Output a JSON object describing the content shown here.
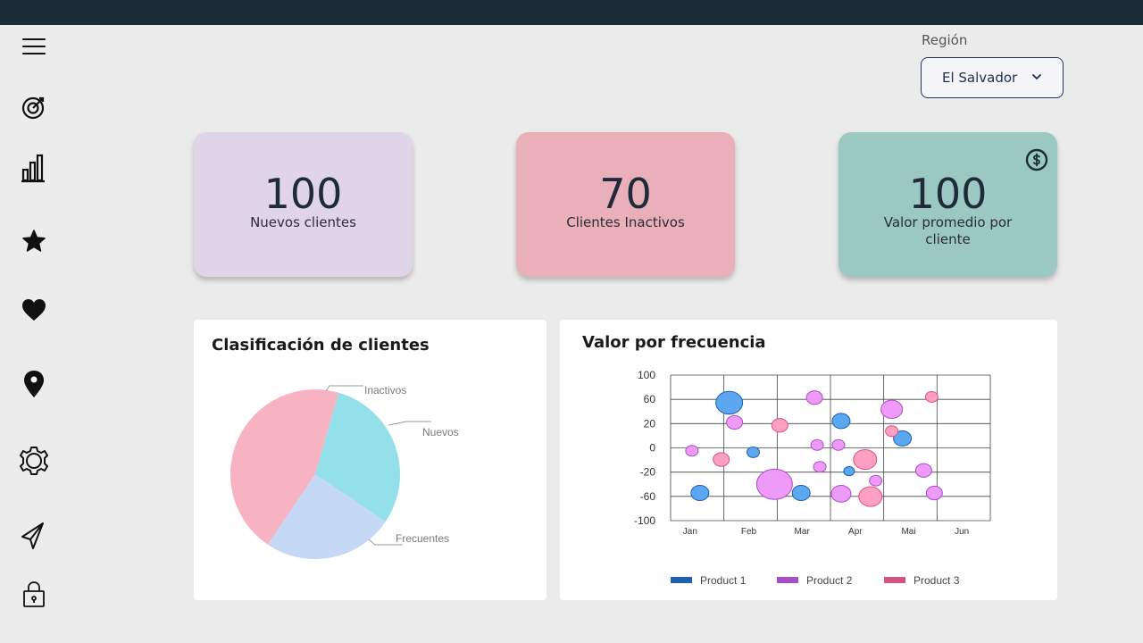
{
  "sidebar": {
    "items": [
      {
        "icon": "menu-icon"
      },
      {
        "icon": "target-icon"
      },
      {
        "icon": "bar-chart-icon"
      },
      {
        "icon": "star-icon"
      },
      {
        "icon": "heart-icon"
      },
      {
        "icon": "map-pin-icon"
      },
      {
        "icon": "settings-icon"
      },
      {
        "icon": "send-icon"
      },
      {
        "icon": "lock-icon"
      }
    ]
  },
  "filter": {
    "label": "Región",
    "value": "El Salvador"
  },
  "kpis": [
    {
      "value": "100",
      "label": "Nuevos clientes",
      "color": "#e0d4e8"
    },
    {
      "value": "70",
      "label": "Clientes Inactivos",
      "color": "#e9b0b9"
    },
    {
      "value": "100",
      "label": "Valor promedio por cliente",
      "color": "#9bc8c1",
      "icon": "dollar-icon"
    }
  ],
  "charts": [
    {
      "title": "Clasificación de clientes",
      "chart_data": {
        "type": "pie",
        "slices": [
          {
            "label": "Inactivos",
            "value": 30,
            "color": "#93e0ea"
          },
          {
            "label": "Nuevos",
            "value": 25,
            "color": "#c5d8f5"
          },
          {
            "label": "Frecuentes",
            "value": 45,
            "color": "#f8b3c2"
          }
        ]
      }
    },
    {
      "title": "Valor por frecuencia",
      "chart_data": {
        "type": "scatter",
        "categories": [
          "Jan",
          "Feb",
          "Mar",
          "Apr",
          "Mai",
          "Jun"
        ],
        "y_ticks": [
          "100",
          "60",
          "20",
          "0",
          "-20",
          "-60",
          "-100"
        ],
        "ylim": [
          -100,
          100
        ],
        "grid": true,
        "legend_position": "bottom",
        "series": [
          {
            "name": "Product 1",
            "color": "#1f5fb0",
            "fill": "#5ba7f0",
            "points": [
              {
                "x": 1.1,
                "y": 62,
                "size": 15
              },
              {
                "x": 1.55,
                "y": -6,
                "size": 7
              },
              {
                "x": 2.45,
                "y": -62,
                "size": 10
              },
              {
                "x": 3.2,
                "y": 37,
                "size": 10
              },
              {
                "x": 3.35,
                "y": -32,
                "size": 6
              },
              {
                "x": 4.35,
                "y": 13,
                "size": 10
              },
              {
                "x": 0.55,
                "y": -62,
                "size": 10
              }
            ]
          },
          {
            "name": "Product 2",
            "color": "#a64fc2",
            "fill": "#ee9af8",
            "points": [
              {
                "x": 0.4,
                "y": -4,
                "size": 7
              },
              {
                "x": 1.2,
                "y": 35,
                "size": 9
              },
              {
                "x": 1.95,
                "y": -50,
                "size": 20
              },
              {
                "x": 2.7,
                "y": 69,
                "size": 9
              },
              {
                "x": 2.75,
                "y": 4,
                "size": 7
              },
              {
                "x": 2.8,
                "y": -26,
                "size": 7
              },
              {
                "x": 3.15,
                "y": 4,
                "size": 7
              },
              {
                "x": 3.2,
                "y": -63,
                "size": 11
              },
              {
                "x": 3.85,
                "y": -45,
                "size": 7
              },
              {
                "x": 4.15,
                "y": 53,
                "size": 12
              },
              {
                "x": 4.75,
                "y": -31,
                "size": 9
              },
              {
                "x": 4.95,
                "y": -62,
                "size": 9
              }
            ]
          },
          {
            "name": "Product 3",
            "color": "#d4537e",
            "fill": "#ff9fc1",
            "points": [
              {
                "x": 0.95,
                "y": -16,
                "size": 9
              },
              {
                "x": 2.05,
                "y": 31,
                "size": 9
              },
              {
                "x": 3.65,
                "y": -16,
                "size": 13
              },
              {
                "x": 3.75,
                "y": -67,
                "size": 13
              },
              {
                "x": 4.15,
                "y": 23,
                "size": 7
              },
              {
                "x": 4.9,
                "y": 70,
                "size": 7
              }
            ]
          }
        ]
      }
    }
  ]
}
